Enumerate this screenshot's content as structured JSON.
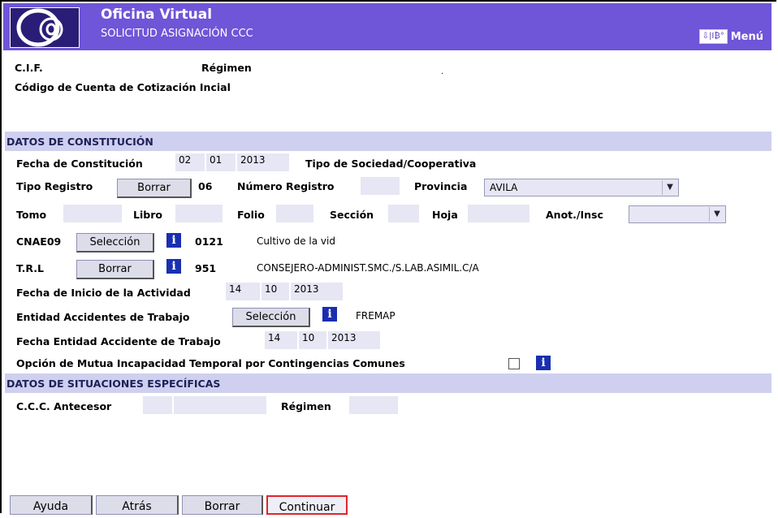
{
  "header": {
    "app_title": "Oficina Virtual",
    "subtitle": "SOLICITUD ASIGNACIÓN CCC",
    "menu_label": "Menú",
    "menu_icon_glyph": "⇩|I₿°",
    "brand_color": "#6f55d8"
  },
  "top": {
    "cif_label": "C.I.F.",
    "regimen_label": "Régimen",
    "ccc_inicial_label": "Código de Cuenta de Cotización Incial",
    "dot": "."
  },
  "constitucion": {
    "section_title": "DATOS DE CONSTITUCIÓN",
    "fecha_label": "Fecha de Constitución",
    "fecha_day": "02",
    "fecha_month": "01",
    "fecha_year": "2013",
    "tipo_sociedad_label": "Tipo de Sociedad/Cooperativa",
    "tipo_registro_label": "Tipo Registro",
    "borrar_label": "Borrar",
    "tipo_registro_code": "06",
    "numero_registro_label": "Número Registro",
    "provincia_label": "Provincia",
    "provincia_value": "AVILA",
    "tomo_label": "Tomo",
    "libro_label": "Libro",
    "folio_label": "Folio",
    "seccion_label": "Sección",
    "hoja_label": "Hoja",
    "anot_label": "Anot./Insc",
    "cnae_label": "CNAE09",
    "seleccion_label": "Selección",
    "cnae_code": "0121",
    "cnae_desc": "Cultivo de la vid",
    "trl_label": "T.R.L",
    "trl_code": "951",
    "trl_desc": "CONSEJERO-ADMINIST.SMC./S.LAB.ASIMIL.C/A",
    "fecha_inicio_label": "Fecha de Inicio de la Actividad",
    "fecha_inicio_day": "14",
    "fecha_inicio_month": "10",
    "fecha_inicio_year": "2013",
    "entidad_label": "Entidad Accidentes de Trabajo",
    "entidad_value": "FREMAP",
    "fecha_entidad_label": "Fecha Entidad Accidente de Trabajo",
    "fecha_entidad_day": "14",
    "fecha_entidad_month": "10",
    "fecha_entidad_year": "2013",
    "opcion_mutua_label": "Opción de Mutua Incapacidad Temporal por Contingencias Comunes",
    "info_glyph": "i"
  },
  "especificas": {
    "section_title": "DATOS DE SITUACIONES ESPECÍFICAS",
    "ccc_antecesor_label": "C.C.C. Antecesor",
    "regimen_label": "Régimen"
  },
  "footer": {
    "ayuda": "Ayuda",
    "atras": "Atrás",
    "borrar": "Borrar",
    "continuar": "Continuar"
  }
}
